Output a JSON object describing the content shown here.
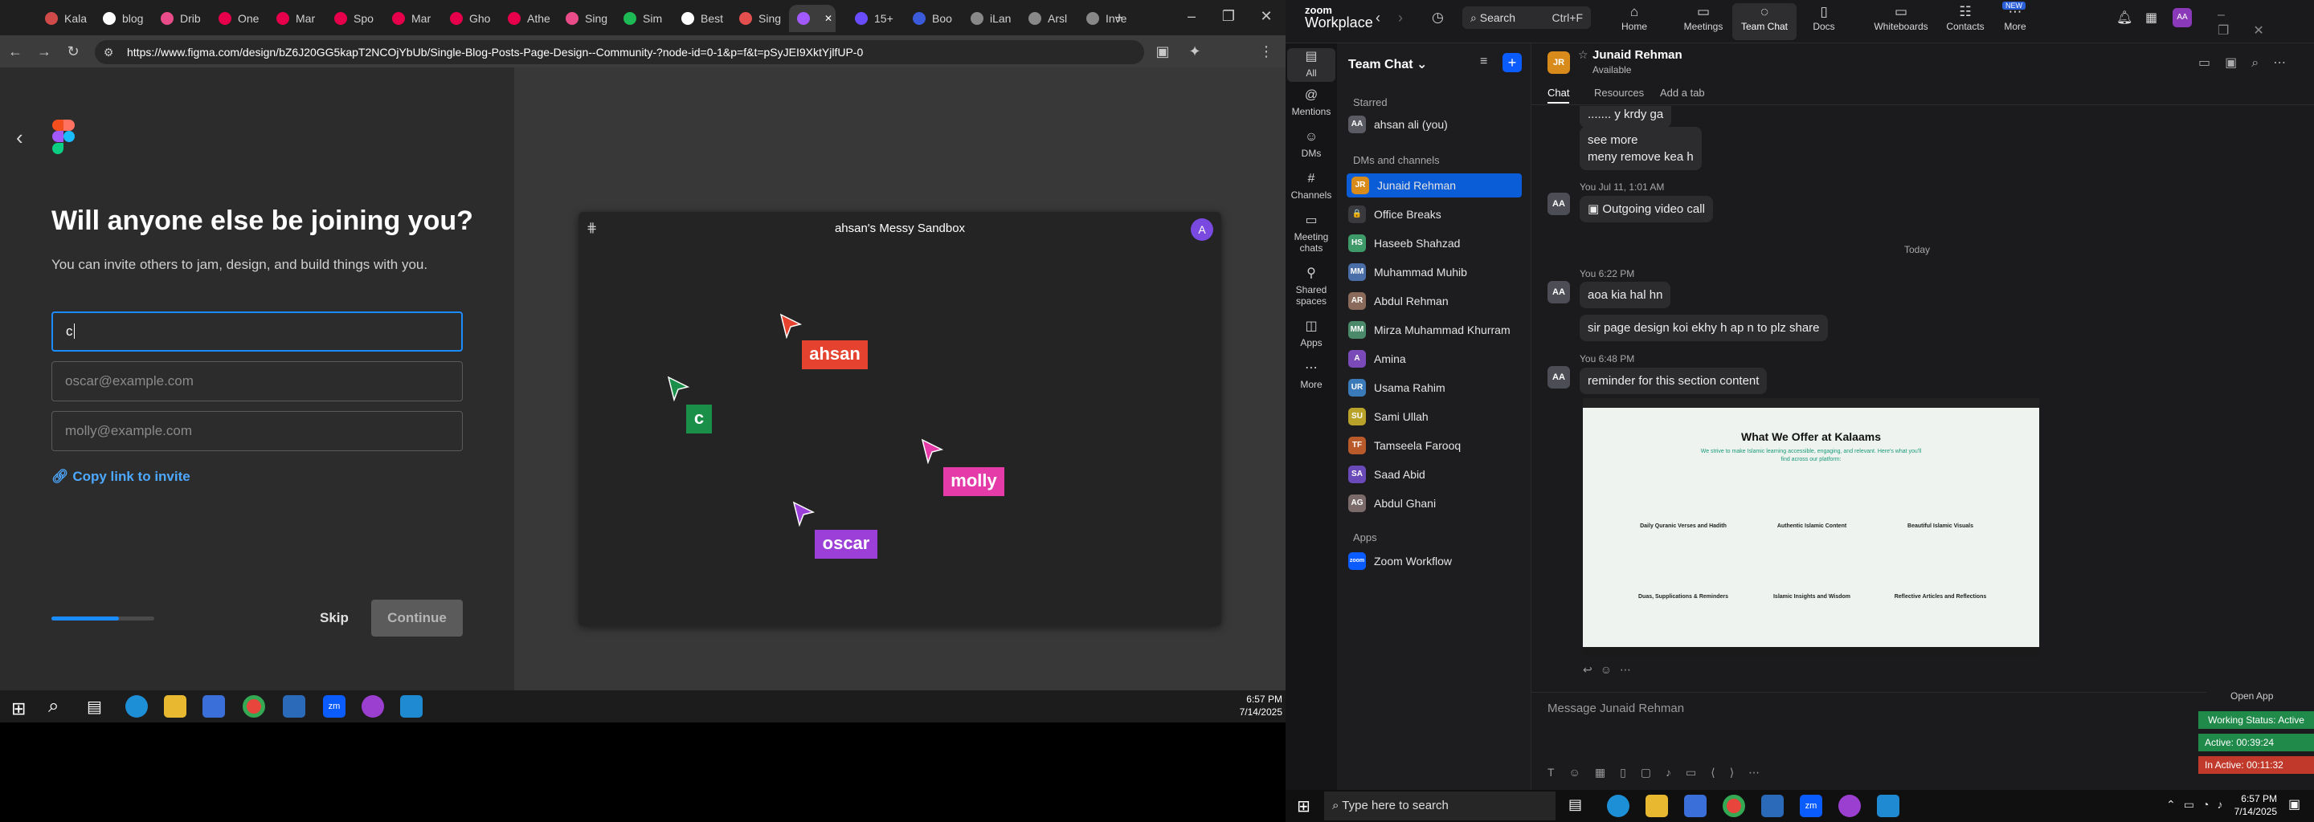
{
  "browser": {
    "tabs": [
      {
        "label": "Kala",
        "color": "#d14a4a"
      },
      {
        "label": "blog",
        "color": "#ffffff"
      },
      {
        "label": "Drib",
        "color": "#ea4c89"
      },
      {
        "label": "One",
        "color": "#e6004c"
      },
      {
        "label": "Mar",
        "color": "#e6004c"
      },
      {
        "label": "Spo",
        "color": "#e6004c"
      },
      {
        "label": "Mar",
        "color": "#e6004c"
      },
      {
        "label": "Gho",
        "color": "#e6004c"
      },
      {
        "label": "Athe",
        "color": "#e6004c"
      },
      {
        "label": "Sing",
        "color": "#ea4c89"
      },
      {
        "label": "Sim",
        "color": "#1db954"
      },
      {
        "label": "Best",
        "color": "#ffffff"
      },
      {
        "label": "Sing",
        "color": "#e34f4f"
      },
      {
        "label": "",
        "color": "#a259ff"
      },
      {
        "label": "15+",
        "color": "#6a4cff"
      },
      {
        "label": "Boo",
        "color": "#3b5bdb"
      },
      {
        "label": "iLan",
        "color": "#888888"
      },
      {
        "label": "Arsl",
        "color": "#888888"
      },
      {
        "label": "Inve",
        "color": "#888888"
      }
    ],
    "url": "https://www.figma.com/design/bZ6J20GG5kapT2NCOjYbUb/Single-Blog-Posts-Page-Design--Community-?node-id=0-1&p=f&t=pSyJEI9XktYjlfUP-0",
    "url_bold": "www.figma.com"
  },
  "figma": {
    "heading": "Will anyone else be joining you?",
    "subtext": "You can invite others to jam, design, and build things with you.",
    "input1_value": "c",
    "input2_placeholder": "oscar@example.com",
    "input3_placeholder": "molly@example.com",
    "copy_link": "Copy link to invite",
    "skip": "Skip",
    "continue": "Continue",
    "progress": 0.66,
    "canvas_title": "ahsan's Messy Sandbox",
    "canvas_avatar": "A",
    "cursors": [
      {
        "label": "ahsan",
        "color": "#e5432f"
      },
      {
        "label": "c",
        "color": "#1a8f4a"
      },
      {
        "label": "molly",
        "color": "#e43ba8"
      },
      {
        "label": "oscar",
        "color": "#9c3fd8"
      }
    ]
  },
  "taskbar_left": {
    "time": "6:57 PM",
    "date": "7/14/2025"
  },
  "zoom": {
    "brand": "zoom",
    "brand_sub": "Workplace",
    "search": "Search",
    "search_shortcut": "Ctrl+F",
    "nav": [
      "Home",
      "Meetings",
      "Team Chat",
      "Docs",
      "Whiteboards",
      "Contacts",
      "More"
    ],
    "new_badge": "NEW",
    "rail": [
      "All",
      "Mentions",
      "DMs",
      "Channels",
      "Meeting chats",
      "Shared spaces",
      "Apps",
      "More"
    ],
    "list_title": "Team Chat",
    "sections": {
      "starred": "Starred",
      "dms": "DMs and channels",
      "apps": "Apps"
    },
    "starred": [
      {
        "name": "ahsan ali (you)",
        "initials": "AA",
        "color": "#5b5b63"
      }
    ],
    "contacts": [
      {
        "name": "Junaid Rehman",
        "initials": "JR",
        "color": "#d88a1a"
      },
      {
        "name": "Office Breaks",
        "initials": "🔒",
        "color": "#3a3a3e"
      },
      {
        "name": "Haseeb Shahzad",
        "initials": "HS",
        "color": "#3f9a6a"
      },
      {
        "name": "Muhammad Muhib",
        "initials": "MM",
        "color": "#4a6ea8"
      },
      {
        "name": "Abdul Rehman",
        "initials": "AR",
        "color": "#8a6a5a"
      },
      {
        "name": "Mirza Muhammad Khurram",
        "initials": "MM",
        "color": "#4a8a6a"
      },
      {
        "name": "Amina",
        "initials": "A",
        "color": "#7a4ab8"
      },
      {
        "name": "Usama Rahim",
        "initials": "UR",
        "color": "#3a7ab8"
      },
      {
        "name": "Sami Ullah",
        "initials": "SU",
        "color": "#b8a22a"
      },
      {
        "name": "Tamseela Farooq",
        "initials": "TF",
        "color": "#b85a2a"
      },
      {
        "name": "Saad Abid",
        "initials": "SA",
        "color": "#6a4ab8"
      },
      {
        "name": "Abdul Ghani",
        "initials": "AG",
        "color": "#7a6a6a"
      }
    ],
    "apps": [
      {
        "name": "Zoom Workflow",
        "initials": "zoom",
        "color": "#0b5cff"
      }
    ],
    "chat": {
      "contact_name": "Junaid Rehman",
      "contact_initials": "JR",
      "status": "Available",
      "tabs": [
        "Chat",
        "Resources",
        "Add a tab"
      ],
      "messages": [
        {
          "text": "....... y krdy ga"
        },
        {
          "text": "see more\nmeny remove kea h"
        },
        {
          "meta": "You Jul 11, 1:01 AM",
          "text": "Outgoing video call"
        },
        {
          "day": "Today"
        },
        {
          "meta": "You 6:22 PM",
          "text": "aoa kia hal hn"
        },
        {
          "text": "sir page design koi ekhy h ap n to plz share"
        },
        {
          "meta": "You 6:48 PM",
          "text": "reminder for this section content"
        }
      ],
      "shot": {
        "title": "What We Offer at Kalaams",
        "sub": "We strive to make Islamic learning accessible, engaging, and relevant. Here's what you'll find across our platform:",
        "items": [
          "Daily Quranic Verses and Hadith",
          "Authentic Islamic Content",
          "Beautiful Islamic Visuals",
          "Duas, Supplications & Reminders",
          "Islamic Insights and Wisdom",
          "Reflective Articles and Reflections"
        ]
      },
      "composer_placeholder": "Message Junaid Rehman",
      "open_app": "Open App",
      "working": "Working Status: Active",
      "active": "Active: 00:39:24",
      "inactive": "In Active: 00:11:32"
    }
  },
  "taskbar_right": {
    "search": "Type here to search",
    "time": "6:57 PM",
    "date": "7/14/2025"
  }
}
